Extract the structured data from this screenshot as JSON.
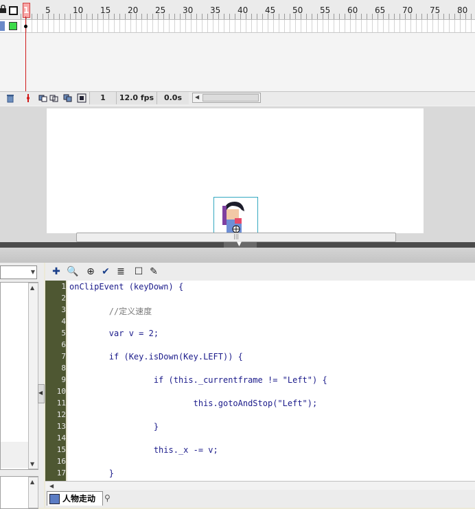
{
  "timeline": {
    "frame_numbers": [
      "1",
      "5",
      "10",
      "15",
      "20",
      "25",
      "30",
      "35",
      "40",
      "45",
      "50",
      "55",
      "60",
      "65",
      "70",
      "75",
      "80"
    ],
    "current_frame": "1",
    "frame_rate": "12.0 fps",
    "elapsed_time": "0.0s"
  },
  "actions_panel": {
    "line_numbers": [
      "1",
      "2",
      "3",
      "4",
      "5",
      "6",
      "7",
      "8",
      "9",
      "10",
      "11",
      "12",
      "13",
      "14",
      "15",
      "16",
      "17"
    ],
    "code_lines": [
      "onClipEvent (keyDown) {",
      "",
      "        //定义速度",
      "",
      "        var v = 2;",
      "",
      "        if (Key.isDown(Key.LEFT)) {",
      "",
      "                 if (this._currentframe != \"Left\") {",
      "",
      "                         this.gotoAndStop(\"Left\");",
      "",
      "                 }",
      "",
      "                 this._x -= v;",
      "",
      "        }"
    ],
    "script_tab_label": "人物走动"
  },
  "colors": {
    "gutter": "#4e5732",
    "layer_color": "#3ddb4b",
    "playhead": "#d01818"
  }
}
